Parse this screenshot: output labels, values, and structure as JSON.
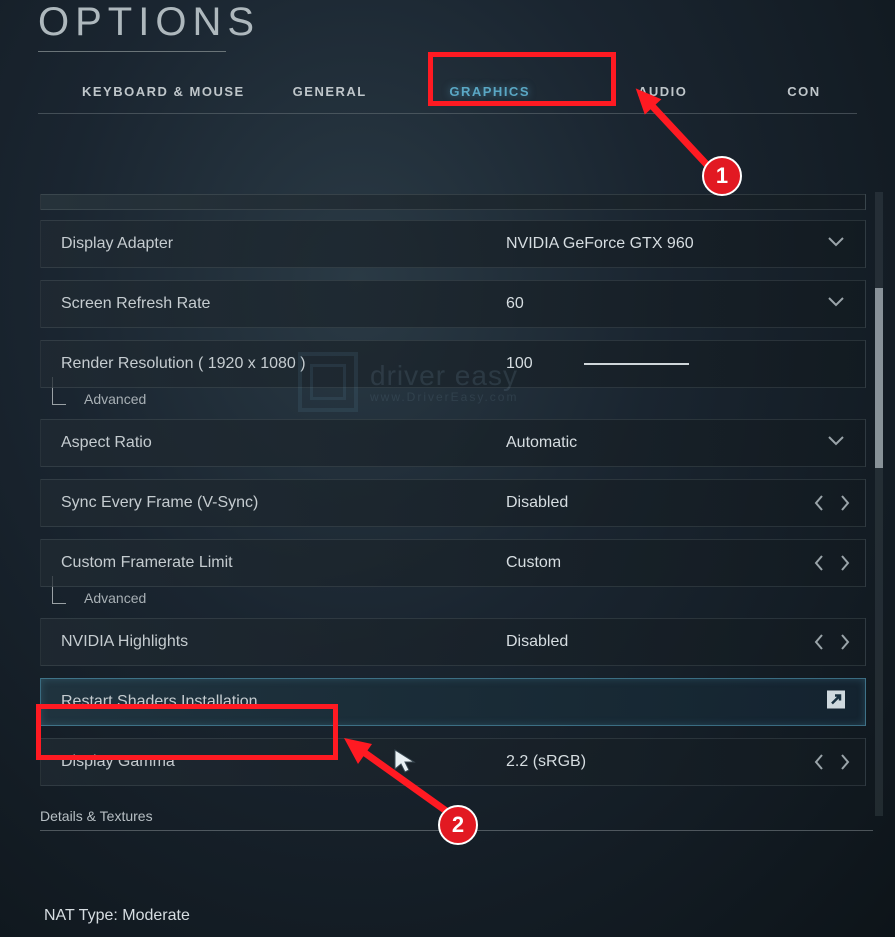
{
  "title": "OPTIONS",
  "tabs": {
    "keyboard_mouse": "KEYBOARD & MOUSE",
    "general": "GENERAL",
    "graphics": "GRAPHICS",
    "audio": "AUDIO",
    "con": "CON"
  },
  "settings": {
    "display_adapter": {
      "label": "Display Adapter",
      "value": "NVIDIA GeForce GTX 960"
    },
    "refresh_rate": {
      "label": "Screen Refresh Rate",
      "value": "60"
    },
    "render_resolution": {
      "label": "Render Resolution ( 1920 x 1080 )",
      "value": "100"
    },
    "aspect_ratio": {
      "label": "Aspect Ratio",
      "value": "Automatic"
    },
    "vsync": {
      "label": "Sync Every Frame (V-Sync)",
      "value": "Disabled"
    },
    "framerate_limit": {
      "label": "Custom Framerate Limit",
      "value": "Custom"
    },
    "nvidia_highlights": {
      "label": "NVIDIA Highlights",
      "value": "Disabled"
    },
    "restart_shaders": {
      "label": "Restart Shaders Installation"
    },
    "display_gamma": {
      "label": "Display Gamma",
      "value": "2.2 (sRGB)"
    }
  },
  "sub_labels": {
    "advanced": "Advanced"
  },
  "section": {
    "details_textures": "Details & Textures"
  },
  "footer": {
    "nat_label": "NAT Type:",
    "nat_value": "Moderate"
  },
  "annotations": {
    "one": "1",
    "two": "2"
  },
  "watermark": {
    "brand": "driver easy",
    "url": "www.DriverEasy.com"
  }
}
